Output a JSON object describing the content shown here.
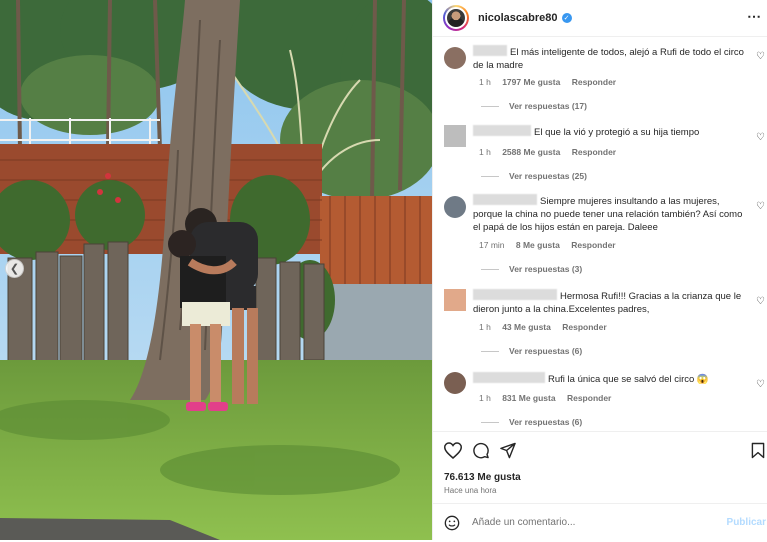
{
  "post": {
    "username": "nicolascabre80",
    "likes_text": "76.613 Me gusta",
    "time_ago": "Hace una hora"
  },
  "comments": [
    {
      "text": "El más inteligente de todos, alejó a Rufi de todo el circo de la madre",
      "time": "1 h",
      "likes": "1797 Me gusta",
      "reply": "Responder",
      "replies": "Ver respuestas (17)"
    },
    {
      "text": "El que la vió y protegió a su hija tiempo",
      "time": "1 h",
      "likes": "2588 Me gusta",
      "reply": "Responder",
      "replies": "Ver respuestas (25)"
    },
    {
      "text": "Siempre mujeres insultando a las mujeres, porque la china no puede tener una relación también? Así como el papá de los hijos están en pareja. Daleee",
      "time": "17 min",
      "likes": "8 Me gusta",
      "reply": "Responder",
      "replies": "Ver respuestas (3)"
    },
    {
      "text": "Hermosa Rufi!!! Gracias a la crianza que le dieron junto a la china.Excelentes padres,",
      "time": "1 h",
      "likes": "43 Me gusta",
      "reply": "Responder",
      "replies": "Ver respuestas (6)"
    },
    {
      "text": "Rufi la única que se salvó del circo 😱",
      "time": "1 h",
      "likes": "831 Me gusta",
      "reply": "Responder",
      "replies": "Ver respuestas (6)"
    }
  ],
  "compose": {
    "placeholder": "Añade un comentario...",
    "publish_label": "Publicar"
  },
  "icons": {
    "like": "heart-icon",
    "comment": "comment-icon",
    "share": "share-icon",
    "save": "bookmark-icon",
    "emoji": "emoji-icon",
    "more": "more-options-icon",
    "prev": "chevron-left-icon"
  },
  "colors": {
    "verified": "#3897f0",
    "publish_disabled": "#b3dbff",
    "muted": "#737373"
  }
}
